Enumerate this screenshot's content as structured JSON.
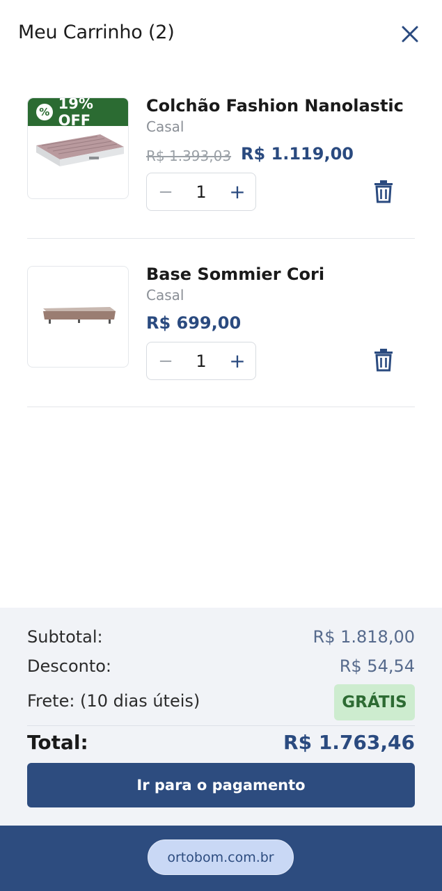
{
  "header": {
    "title": "Meu Carrinho (2)"
  },
  "items": [
    {
      "badge": "19% OFF",
      "badge_icon": "%",
      "name": "Colchão Fashion Nanolastic",
      "variant": "Casal",
      "old_price": "R$ 1.393,03",
      "price": "R$ 1.119,00",
      "quantity": "1",
      "minus": "−",
      "plus": "+"
    },
    {
      "name": "Base Sommier Cori",
      "variant": "Casal",
      "price": "R$ 699,00",
      "quantity": "1",
      "minus": "−",
      "plus": "+"
    }
  ],
  "summary": {
    "subtotal_label": "Subtotal:",
    "subtotal_value": "R$ 1.818,00",
    "discount_label": "Desconto:",
    "discount_value": "R$ 54,54",
    "shipping_label": "Frete: (10 dias úteis)",
    "shipping_value": "GRÁTIS",
    "total_label": "Total:",
    "total_value": "R$ 1.763,46",
    "checkout_button": "Ir para o pagamento"
  },
  "browser": {
    "url": "ortobom.com.br"
  },
  "colors": {
    "primary": "#2d4c7f",
    "price": "#2a4a7f",
    "badge_green": "#2b6b32",
    "free_bg": "#cdeccf",
    "free_text": "#2d6b33",
    "summary_bg": "#f1f3f7"
  },
  "icons": {
    "close": "close-icon",
    "trash": "trash-icon",
    "discount": "percent-icon"
  }
}
